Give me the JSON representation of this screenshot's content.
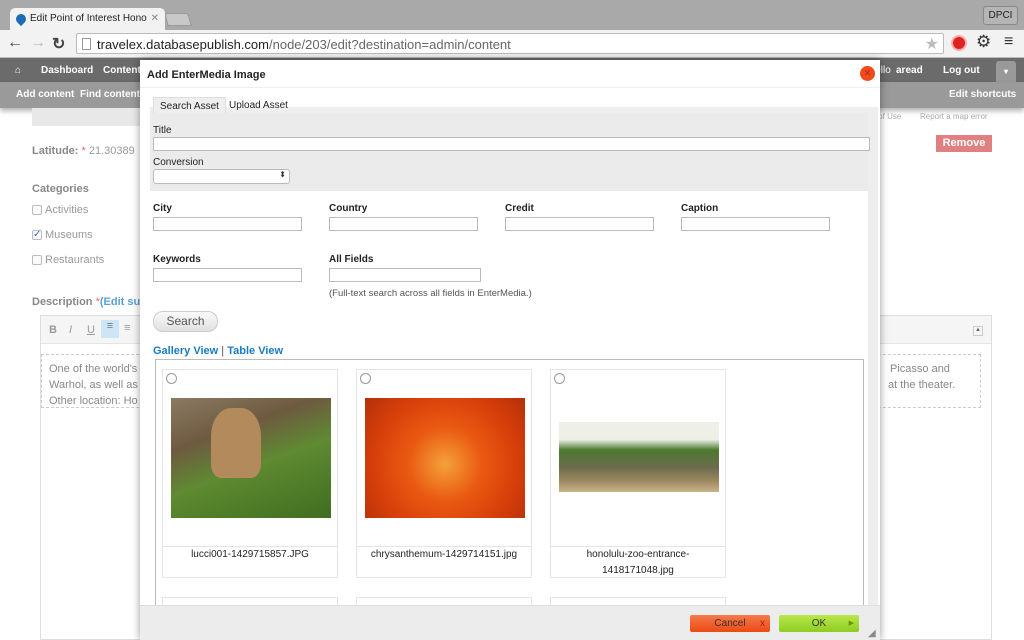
{
  "browser": {
    "tab_title": "Edit Point of Interest Hono",
    "profile": "DPCI",
    "url_host": "travelex.databasepublish.com",
    "url_path": "/node/203/edit?destination=admin/content"
  },
  "toolbar": {
    "items": [
      "Dashboard",
      "Content"
    ],
    "hello": "Hello",
    "user": "aread",
    "logout": "Log out",
    "shortcuts": [
      "Add content",
      "Find content"
    ],
    "edit_shortcuts": "Edit shortcuts"
  },
  "page": {
    "map_links": [
      "s of Use",
      "Report a map error"
    ],
    "latitude_label": "Latitude:",
    "required": "*",
    "latitude_value": "21.30389",
    "categories_label": "Categories",
    "categories": [
      {
        "label": "Activities",
        "checked": false
      },
      {
        "label": "Museums",
        "checked": true
      },
      {
        "label": "Restaurants",
        "checked": false
      }
    ],
    "description_label": "Description",
    "edit_summary": "(Edit su",
    "remove": "Remove",
    "editor_tools": [
      "B",
      "I",
      "U"
    ],
    "editor_lines_left": [
      "One of the world's",
      "Warhol, as well as",
      "Other location: Ho"
    ],
    "editor_lines_right": [
      "Picasso and",
      "at the theater."
    ]
  },
  "modal": {
    "title": "Add EnterMedia Image",
    "tabs": [
      "Search Asset",
      "Upload Asset"
    ],
    "title_label": "Title",
    "conversion_label": "Conversion",
    "conversion_value": "",
    "fields": [
      "City",
      "Country",
      "Credit",
      "Caption"
    ],
    "keywords_label": "Keywords",
    "all_fields_label": "All Fields",
    "all_fields_help": "(Full-text search across all fields in EnterMedia.)",
    "search_button": "Search",
    "gallery_view": "Gallery View",
    "separator": "|",
    "table_view": "Table View",
    "images": [
      {
        "file": "lucci001-1429715857.JPG"
      },
      {
        "file": "chrysanthemum-1429714151.jpg"
      },
      {
        "file": "honolulu-zoo-entrance-1418171048.jpg"
      }
    ],
    "cancel": "Cancel",
    "cancel_x": "x",
    "ok": "OK"
  },
  "colors": {
    "cancel": "#f0582a",
    "ok": "#9ed62c",
    "remove": "#e08080",
    "link": "#1a7bc4"
  }
}
